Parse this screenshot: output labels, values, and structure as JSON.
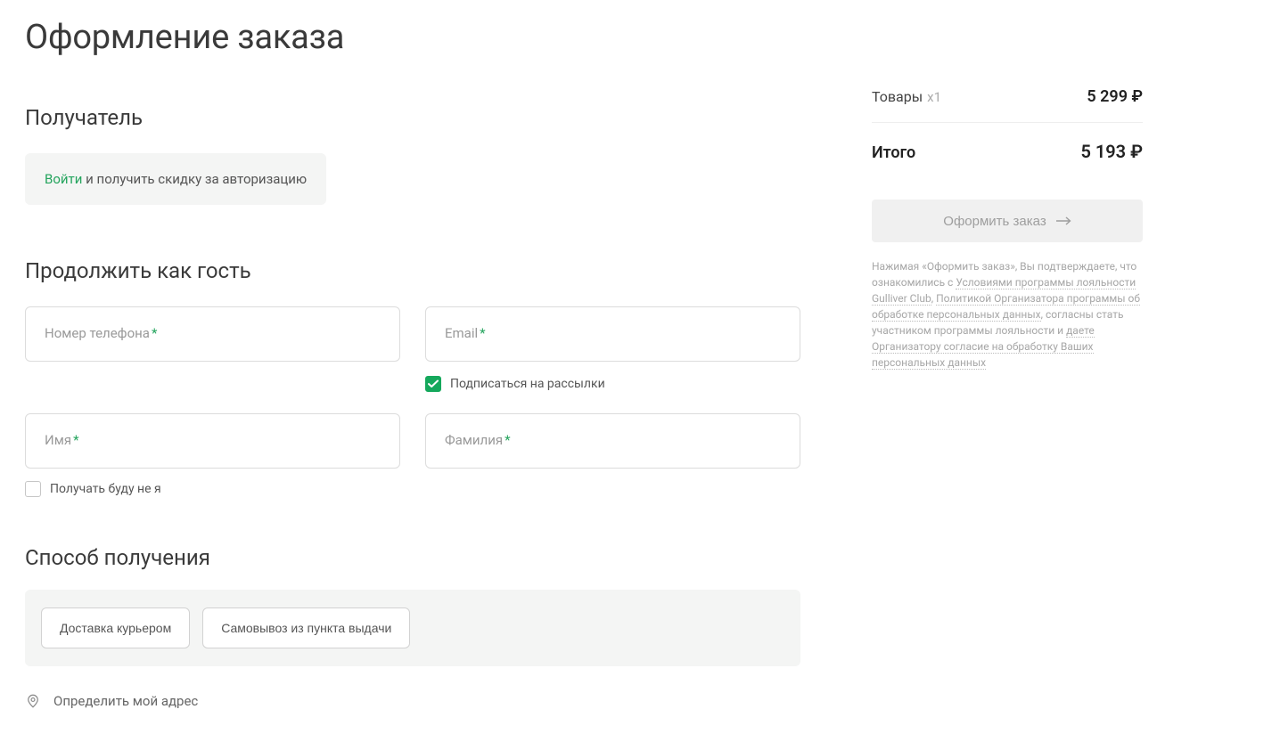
{
  "page_title": "Оформление заказа",
  "recipient": {
    "heading": "Получатель",
    "login_link": "Войти",
    "login_suffix": " и получить скидку за авторизацию"
  },
  "guest": {
    "heading": "Продолжить как гость",
    "phone_label": "Номер телефона",
    "email_label": "Email",
    "first_name_label": "Имя",
    "last_name_label": "Фамилия",
    "subscribe_label": "Подписаться на рассылки",
    "subscribe_checked": true,
    "someone_else_label": "Получать буду не я",
    "someone_else_checked": false,
    "ast": "*"
  },
  "delivery": {
    "heading": "Способ получения",
    "courier_label": "Доставка курьером",
    "pickup_label": "Самовывоз из пункта выдачи",
    "locate_label": "Определить мой адрес"
  },
  "summary": {
    "items_label": "Товары",
    "items_count": "x1",
    "items_price": "5 299 ₽",
    "total_label": "Итого",
    "total_price": "5 193 ₽",
    "cta_label": "Оформить заказ"
  },
  "disclaimer": {
    "t1": "Нажимая «Оформить заказ», Вы подтверждаете, что ознакомились с ",
    "l1": "Условиями программы лояльности Gulliver Club",
    "t2": ", ",
    "l2": "Политикой Организатора программы об обработке персональных данных",
    "t3": ", согласны стать участником программы лояльности и ",
    "l3": "даете Организатору согласие на обработку Ваших персональных данных"
  }
}
